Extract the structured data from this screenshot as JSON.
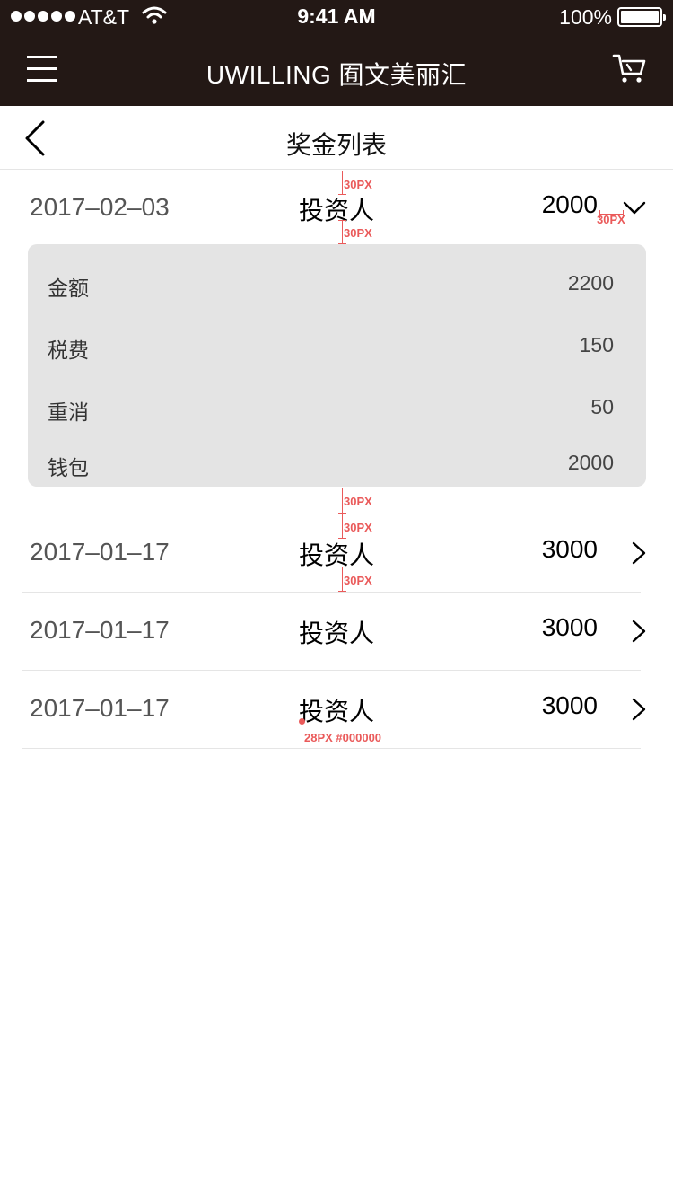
{
  "status_bar": {
    "carrier": "AT&T",
    "time": "9:41 AM",
    "battery": "100%"
  },
  "navbar": {
    "title": "UWILLING 囿文美丽汇",
    "menu_icon": "hamburger-menu-icon",
    "cart_icon": "shopping-cart-icon"
  },
  "page": {
    "title": "奖金列表",
    "back_icon": "chevron-left-icon"
  },
  "rows": [
    {
      "date": "2017–02–03",
      "role": "投资人",
      "amount": "2000",
      "expanded": true,
      "details": [
        {
          "label": "金额",
          "value": "2200"
        },
        {
          "label": "税费",
          "value": "150"
        },
        {
          "label": "重消",
          "value": "50"
        },
        {
          "label": "钱包",
          "value": "2000"
        }
      ]
    },
    {
      "date": "2017–01–17",
      "role": "投资人",
      "amount": "3000",
      "expanded": false
    },
    {
      "date": "2017–01–17",
      "role": "投资人",
      "amount": "3000",
      "expanded": false
    },
    {
      "date": "2017–01–17",
      "role": "投资人",
      "amount": "3000",
      "expanded": false
    }
  ],
  "annotations": {
    "spacing": "30PX",
    "font_spec": "28PX #000000"
  },
  "colors": {
    "header_bg": "#231815",
    "panel_bg": "#e4e4e4",
    "annotation": "#ea5a5a",
    "divider": "#e5e5e5"
  }
}
